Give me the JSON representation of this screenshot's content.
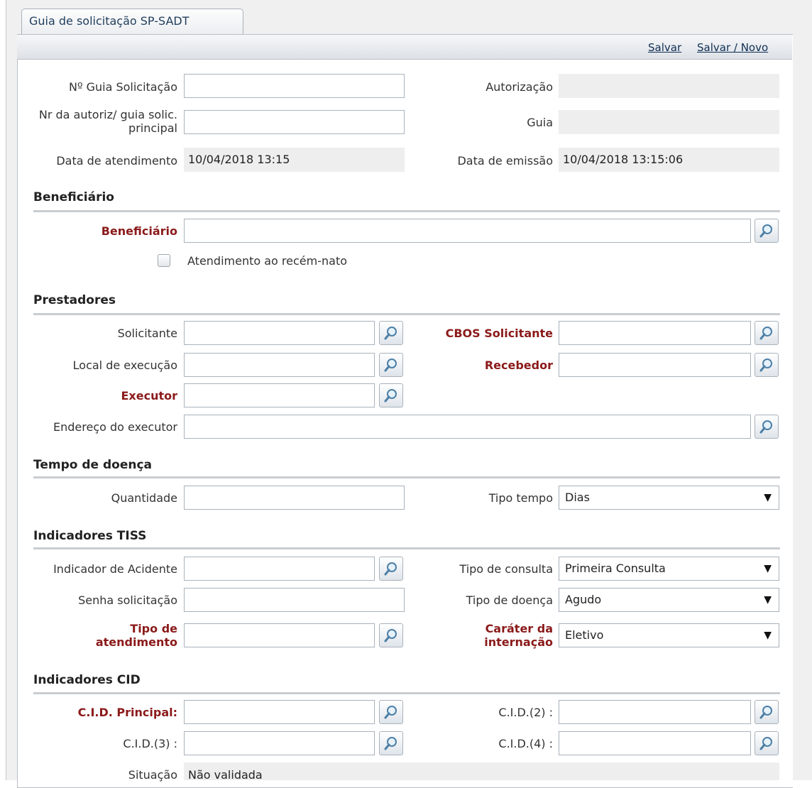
{
  "tab_title": "Guia de solicitação SP-SADT",
  "toolbar": {
    "save": "Salvar",
    "save_new": "Salvar / Novo"
  },
  "guia": {
    "num_guia_label": "Nº Guia Solicitação",
    "num_guia_value": "",
    "autorizacao_label": "Autorização",
    "autorizacao_value": "",
    "nr_autoriz_label": "Nr da autoriz/ guia solic. principal",
    "nr_autoriz_value": "",
    "guia_label": "Guia",
    "guia_value": "",
    "data_atendimento_label": "Data de atendimento",
    "data_atendimento_value": "10/04/2018 13:15",
    "data_emissao_label": "Data de emissão",
    "data_emissao_value": "10/04/2018 13:15:06"
  },
  "beneficiario": {
    "section_title": "Beneficiário",
    "beneficiario_label": "Beneficiário",
    "beneficiario_value": "",
    "recem_nato_label": "Atendimento ao recém-nato",
    "recem_nato_checked": false
  },
  "prestadores": {
    "section_title": "Prestadores",
    "solicitante_label": "Solicitante",
    "cbos_label": "CBOS Solicitante",
    "local_exec_label": "Local de execução",
    "recebedor_label": "Recebedor",
    "executor_label": "Executor",
    "endereco_label": "Endereço do executor"
  },
  "tempo_doenca": {
    "section_title": "Tempo de doença",
    "quantidade_label": "Quantidade",
    "quantidade_value": "",
    "tipo_tempo_label": "Tipo tempo",
    "tipo_tempo_value": "Dias"
  },
  "tiss": {
    "section_title": "Indicadores TISS",
    "acidente_label": "Indicador de Acidente",
    "tipo_consulta_label": "Tipo de consulta",
    "tipo_consulta_value": "Primeira Consulta",
    "senha_label": "Senha solicitação",
    "tipo_doenca_label": "Tipo de doença",
    "tipo_doenca_value": "Agudo",
    "tipo_atendimento_label": "Tipo de atendimento",
    "carater_label": "Caráter da internação",
    "carater_value": "Eletivo"
  },
  "cid": {
    "section_title": "Indicadores CID",
    "cid_principal_label": "C.I.D. Principal:",
    "cid2_label": "C.I.D.(2) :",
    "cid3_label": "C.I.D.(3) :",
    "cid4_label": "C.I.D.(4) :",
    "situacao_label": "Situação",
    "situacao_value": "Não validada"
  },
  "icons": {
    "lookup": "magnifier-icon",
    "dropdown": "triangle-down-icon"
  },
  "colors": {
    "required_label": "#8b1a1a",
    "section_rule": "#c9cdd1",
    "tab_text": "#1f3d5c"
  }
}
